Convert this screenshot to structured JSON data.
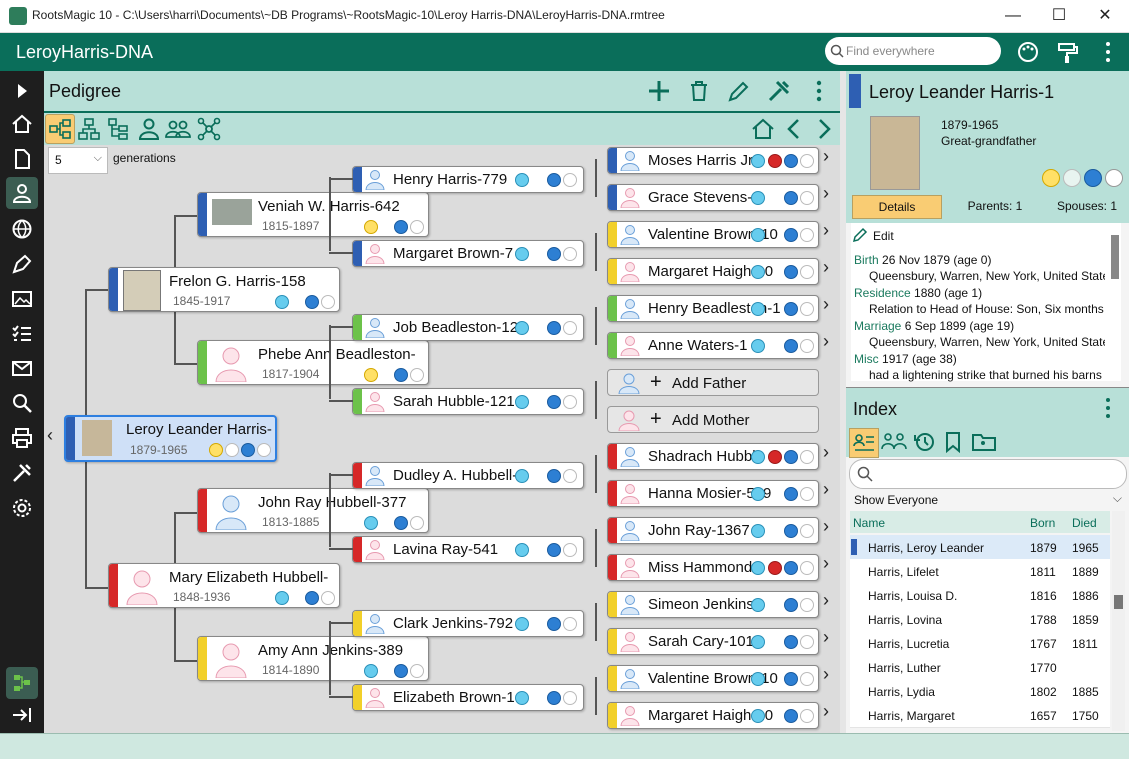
{
  "window": {
    "title": "RootsMagic 10 - C:\\Users\\harri\\Documents\\~DB Programs\\~RootsMagic-10\\Leroy Harris-DNA\\LeroyHarris-DNA.rmtree",
    "minimize": "—",
    "maximize": "☐",
    "close": "✕"
  },
  "app": {
    "name": "LeroyHarris-DNA",
    "search_placeholder": "Find everywhere"
  },
  "pedigree": {
    "title": "Pedigree",
    "generations_value": "5",
    "generations_label": "generations",
    "people": [
      {
        "name": "Leroy Leander Harris-",
        "dates": "1879-1965",
        "color": "#2e5fb3"
      },
      {
        "name": "Frelon G. Harris-158",
        "dates": "1845-1917",
        "color": "#2e5fb3"
      },
      {
        "name": "Mary Elizabeth Hubbell-",
        "dates": "1848-1936",
        "color": "#d62828"
      },
      {
        "name": "Veniah W. Harris-642",
        "dates": "1815-1897",
        "color": "#2e5fb3"
      },
      {
        "name": "Phebe Ann Beadleston-",
        "dates": "1817-1904",
        "color": "#6cc24a"
      },
      {
        "name": "John Ray Hubbell-377",
        "dates": "1813-1885",
        "color": "#d62828"
      },
      {
        "name": "Amy Ann Jenkins-389",
        "dates": "1814-1890",
        "color": "#f2d02a"
      },
      {
        "name": "Henry Harris-779",
        "color": "#2e5fb3"
      },
      {
        "name": "Margaret Brown-7",
        "color": "#2e5fb3"
      },
      {
        "name": "Job Beadleston-12",
        "color": "#6cc24a"
      },
      {
        "name": "Sarah Hubble-121",
        "color": "#6cc24a"
      },
      {
        "name": "Dudley A. Hubbell-",
        "color": "#d62828"
      },
      {
        "name": "Lavina Ray-541",
        "color": "#d62828"
      },
      {
        "name": "Clark Jenkins-792",
        "color": "#f2d02a"
      },
      {
        "name": "Elizabeth Brown-1",
        "color": "#f2d02a"
      },
      {
        "name": "Moses Harris Jr",
        "color": "#2e5fb3"
      },
      {
        "name": "Grace Stevens-",
        "color": "#2e5fb3"
      },
      {
        "name": "Valentine Brown-10",
        "color": "#f2d02a"
      },
      {
        "name": "Margaret Haigh-10",
        "color": "#f2d02a"
      },
      {
        "name": "Henry Beadleston-1",
        "color": "#6cc24a"
      },
      {
        "name": "Anne Waters-1",
        "color": "#6cc24a"
      },
      {
        "name": "Shadrach Hubbl",
        "color": "#d62828"
      },
      {
        "name": "Hanna Mosier-589",
        "color": "#d62828"
      },
      {
        "name": "John Ray-1367",
        "color": "#d62828"
      },
      {
        "name": "Miss Hammond",
        "color": "#d62828"
      },
      {
        "name": "Simeon Jenkins",
        "color": "#f2d02a"
      },
      {
        "name": "Sarah Cary-101",
        "color": "#f2d02a"
      },
      {
        "name": "Valentine Brown-10",
        "color": "#f2d02a"
      },
      {
        "name": "Margaret Haigh-10",
        "color": "#f2d02a"
      }
    ],
    "add_father": "Add Father",
    "add_mother": "Add Mother"
  },
  "person_panel": {
    "name": "Leroy Leander Harris-1",
    "years": "1879-1965",
    "relationship": "Great-grandfather",
    "tabs": {
      "details": "Details",
      "parents": "Parents: 1",
      "spouses": "Spouses: 1"
    },
    "edit_label": "Edit",
    "facts": [
      {
        "type": "Birth",
        "value": "26 Nov 1879 (age 0)",
        "detail": "Queensbury, Warren, New York, United States"
      },
      {
        "type": "Residence",
        "value": "1880 (age 1)",
        "detail": "Relation to Head of House: Son, Six months c"
      },
      {
        "type": "Marriage",
        "value": "6 Sep 1899 (age 19)",
        "detail": "Queensbury, Warren, New York, United States"
      },
      {
        "type": "Misc",
        "value": "1917 (age 38)",
        "detail": "had a lightening strike that burned his barns"
      }
    ]
  },
  "index": {
    "title": "Index",
    "filter": "Show Everyone",
    "columns": {
      "name": "Name",
      "born": "Born",
      "died": "Died"
    },
    "rows": [
      {
        "name": "Harris, Leroy Leander",
        "born": "1879",
        "died": "1965",
        "selected": true
      },
      {
        "name": "Harris, Lifelet",
        "born": "1811",
        "died": "1889"
      },
      {
        "name": "Harris, Louisa D.",
        "born": "1816",
        "died": "1886"
      },
      {
        "name": "Harris, Lovina",
        "born": "1788",
        "died": "1859"
      },
      {
        "name": "Harris, Lucretia",
        "born": "1767",
        "died": "1811"
      },
      {
        "name": "Harris, Luther",
        "born": "1770",
        "died": ""
      },
      {
        "name": "Harris, Lydia",
        "born": "1802",
        "died": "1885"
      },
      {
        "name": "Harris, Margaret",
        "born": "1657",
        "died": "1750"
      }
    ]
  }
}
